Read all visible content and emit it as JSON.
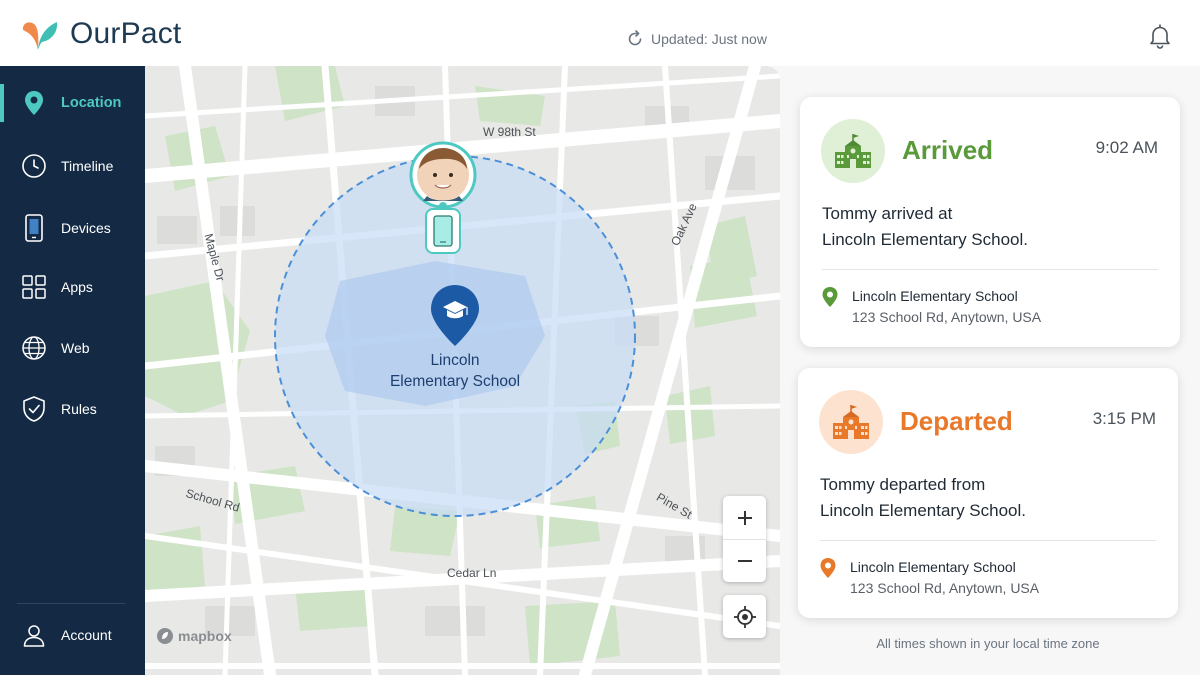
{
  "app": {
    "name": "OurPact"
  },
  "header": {
    "updated_text": "Updated: Just now"
  },
  "sidebar": {
    "items": [
      {
        "label": "Location",
        "icon": "location-pin-icon",
        "active": true
      },
      {
        "label": "Timeline",
        "icon": "clock-icon"
      },
      {
        "label": "Devices",
        "icon": "phone-icon"
      },
      {
        "label": "Apps",
        "icon": "apps-grid-icon"
      },
      {
        "label": "Web",
        "icon": "globe-icon"
      },
      {
        "label": "Rules",
        "icon": "shield-check-icon"
      }
    ],
    "account_label": "Account"
  },
  "map": {
    "streets": [
      "W 98th St",
      "Maple Dr",
      "Oak Ave",
      "School Rd",
      "Pine St",
      "Cedar Ln"
    ],
    "school_label_line1": "Lincoln",
    "school_label_line2": "Elementary School",
    "attribution": "mapbox",
    "zoom_in": "+",
    "zoom_out": "−"
  },
  "events": [
    {
      "status": "Arrived",
      "time": "9:02 AM",
      "message_line1": "Tommy arrived at",
      "message_line2": "Lincoln Elementary School.",
      "location_name": "Lincoln Elementary School",
      "location_address": "123 School Rd, Anytown, USA",
      "color": "#5a9a3a",
      "icon": "school-icon"
    },
    {
      "status": "Departed",
      "time": "3:15 PM",
      "message_line1": "Tommy departed from",
      "message_line2": "Lincoln Elementary School.",
      "location_name": "Lincoln Elementary School",
      "location_address": "123 School Rd, Anytown, USA",
      "color": "#e8782a",
      "icon": "school-icon"
    }
  ],
  "footnote": "All times shown in your local time zone",
  "colors": {
    "sidebar_bg": "#142a44",
    "accent_teal": "#4ec9c1",
    "geofence_blue": "#4a90d9",
    "school_pin": "#1d5aa6",
    "arrived_green": "#5a9a3a",
    "departed_orange": "#e8782a"
  }
}
